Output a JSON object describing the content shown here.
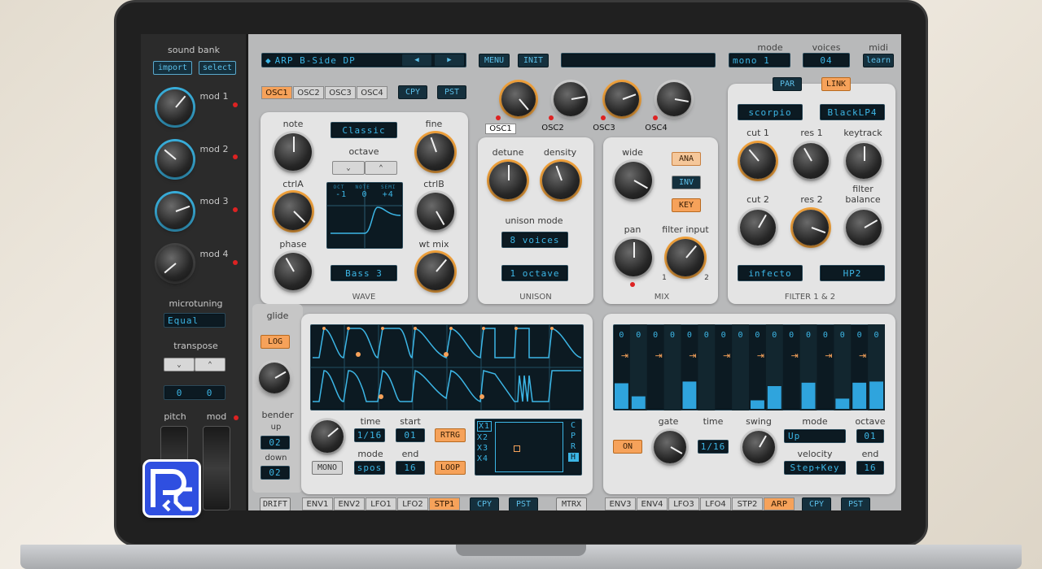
{
  "preset": {
    "name": "ARP B-Side DP"
  },
  "header": {
    "menu": "MENU",
    "init": "INIT",
    "mode_label": "mode",
    "mode_value": "mono 1",
    "voices_label": "voices",
    "voices_value": "04",
    "midi_label": "midi",
    "learn": "learn"
  },
  "sidebar": {
    "sound_bank": "sound bank",
    "import": "import",
    "select": "select",
    "mods": [
      "mod 1",
      "mod 2",
      "mod 3",
      "mod 4"
    ],
    "microtuning": "microtuning",
    "micro_value": "Equal",
    "transpose": "transpose",
    "transpose_values": [
      "0",
      "0"
    ],
    "pitch": "pitch",
    "mod": "mod"
  },
  "osc": {
    "tabs": [
      "OSC1",
      "OSC2",
      "OSC3",
      "OSC4"
    ],
    "cpy": "CPY",
    "pst": "PST",
    "knob_labels": [
      "OSC1",
      "OSC2",
      "OSC3",
      "OSC4"
    ],
    "note": "note",
    "fine": "fine",
    "wave_type": "Classic",
    "octave": "octave",
    "ctrlA": "ctrlA",
    "ctrlB": "ctrlB",
    "phase": "phase",
    "wt_mix": "wt mix",
    "wave_name": "Bass 3",
    "wave_label": "WAVE",
    "screen_headers": [
      "OCT",
      "NOTE",
      "SEMI"
    ],
    "screen_values": [
      "-1",
      "0",
      "+4"
    ]
  },
  "unison": {
    "detune": "detune",
    "density": "density",
    "mode_label": "unison mode",
    "voices": "8 voices",
    "octave": "1 octave",
    "label": "UNISON"
  },
  "mix": {
    "wide": "wide",
    "ana": "ANA",
    "inv": "INV",
    "key": "KEY",
    "pan": "pan",
    "filter_input": "filter input",
    "one": "1",
    "two": "2",
    "label": "MIX"
  },
  "filter": {
    "par": "PAR",
    "link": "LINK",
    "type1": "scorpio",
    "type2": "BlackLP4",
    "cut1": "cut 1",
    "res1": "res 1",
    "keytrack": "keytrack",
    "cut2": "cut 2",
    "res2": "res 2",
    "balance_l1": "filter",
    "balance_l2": "balance",
    "mode1": "infecto",
    "mode2": "HP2",
    "label": "FILTER 1 & 2"
  },
  "glide": {
    "label": "glide",
    "log": "LOG",
    "bender": "bender",
    "up": "up",
    "up_val": "02",
    "down": "down",
    "down_val": "02"
  },
  "step": {
    "time": "time",
    "time_val": "1/16",
    "start": "start",
    "start_val": "01",
    "rtrg": "RTRG",
    "mono": "MONO",
    "mode": "mode",
    "mode_val": "spos",
    "end": "end",
    "end_val": "16",
    "loop": "LOOP",
    "xlist": [
      "X1",
      "X2",
      "X3",
      "X4"
    ],
    "cplist": [
      "C",
      "P",
      "R",
      "H"
    ]
  },
  "arp": {
    "steps": [
      "0",
      "0",
      "0",
      "0",
      "0",
      "0",
      "0",
      "0",
      "0",
      "0",
      "0",
      "0",
      "0",
      "0",
      "0",
      "0"
    ],
    "vel": [
      0.45,
      0.22,
      0,
      0,
      0.48,
      0,
      0,
      0,
      0.15,
      0.4,
      0,
      0.46,
      0,
      0.18,
      0.46,
      0.48
    ],
    "on": "ON",
    "gate": "gate",
    "time": "time",
    "time_val": "1/16",
    "swing": "swing",
    "mode": "mode",
    "mode_val": "Up",
    "octave": "octave",
    "octave_val": "01",
    "velocity": "velocity",
    "velocity_val": "Step+Key",
    "end": "end",
    "end_val": "16"
  },
  "bottom_left": {
    "drift": "DRIFT",
    "tabs": [
      "ENV1",
      "ENV2",
      "LFO1",
      "LFO2",
      "STP1"
    ],
    "cpy": "CPY",
    "pst": "PST",
    "mtrx": "MTRX"
  },
  "bottom_right": {
    "tabs": [
      "ENV3",
      "ENV4",
      "LFO3",
      "LFO4",
      "STP2",
      "ARP"
    ],
    "cpy": "CPY",
    "pst": "PST"
  },
  "colors": {
    "accent": "#f6a25a",
    "lcd_text": "#3cb6e6",
    "panel": "#e4e4e4"
  }
}
